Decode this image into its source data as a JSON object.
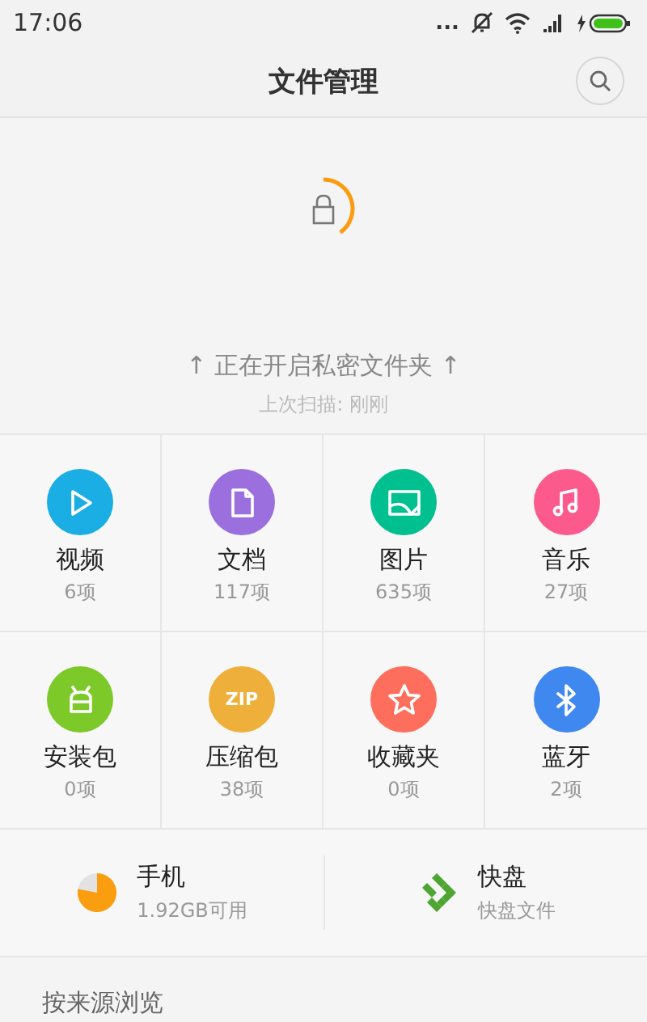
{
  "status_bar": {
    "time": "17:06",
    "dots": "..."
  },
  "header": {
    "title": "文件管理"
  },
  "private_folder": {
    "message": "↑ 正在开启私密文件夹 ↑",
    "last_scan": "上次扫描: 刚刚"
  },
  "categories": [
    {
      "kind": "video",
      "name": "视频",
      "count": "6项",
      "color": "#1aaee5"
    },
    {
      "kind": "document",
      "name": "文档",
      "count": "117项",
      "color": "#9b6fdd"
    },
    {
      "kind": "image",
      "name": "图片",
      "count": "635项",
      "color": "#00c090"
    },
    {
      "kind": "music",
      "name": "音乐",
      "count": "27项",
      "color": "#fc5a8d"
    },
    {
      "kind": "apk",
      "name": "安装包",
      "count": "0项",
      "color": "#7dc92a"
    },
    {
      "kind": "zip",
      "name": "压缩包",
      "count": "38项",
      "color": "#eeb03a",
      "icon_text": "ZIP"
    },
    {
      "kind": "favorite",
      "name": "收藏夹",
      "count": "0项",
      "color": "#fd6f5c"
    },
    {
      "kind": "bluetooth",
      "name": "蓝牙",
      "count": "2项",
      "color": "#3f88f0"
    }
  ],
  "storage": [
    {
      "kind": "phone",
      "name": "手机",
      "detail": "1.92GB可用"
    },
    {
      "kind": "cloud",
      "name": "快盘",
      "detail": "快盘文件"
    }
  ],
  "section": {
    "title": "按来源浏览"
  }
}
